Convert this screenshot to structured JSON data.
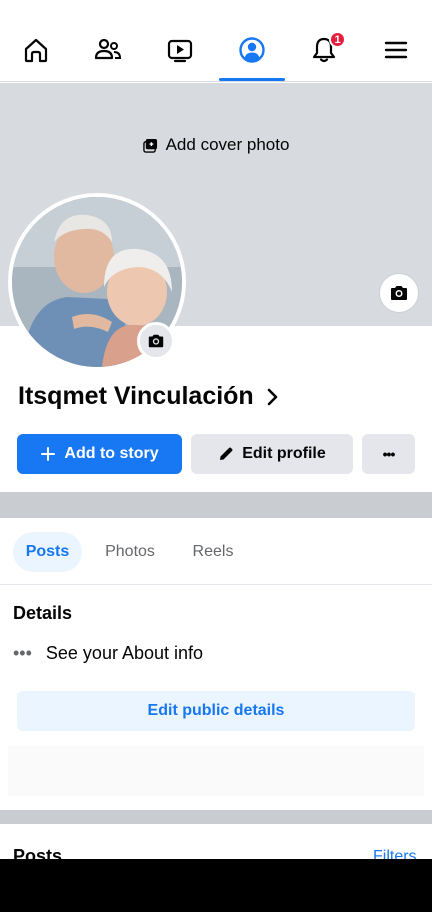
{
  "nav": {
    "notifications_badge": "1"
  },
  "cover": {
    "add_cover_label": "Add cover photo"
  },
  "profile": {
    "name": "Itsqmet Vinculación"
  },
  "actions": {
    "add_story_label": "Add to story",
    "edit_profile_label": "Edit profile",
    "more_label": "•••"
  },
  "tabs": [
    {
      "label": "Posts",
      "active": true
    },
    {
      "label": "Photos",
      "active": false
    },
    {
      "label": "Reels",
      "active": false
    }
  ],
  "details": {
    "title": "Details",
    "about_dots": "•••",
    "about_label": "See your About info",
    "edit_public_label": "Edit public details"
  },
  "posts": {
    "title": "Posts",
    "filters_label": "Filters"
  },
  "colors": {
    "accent": "#1877f2",
    "badge": "#e41e3f",
    "cover_bg": "#d7dadf"
  }
}
